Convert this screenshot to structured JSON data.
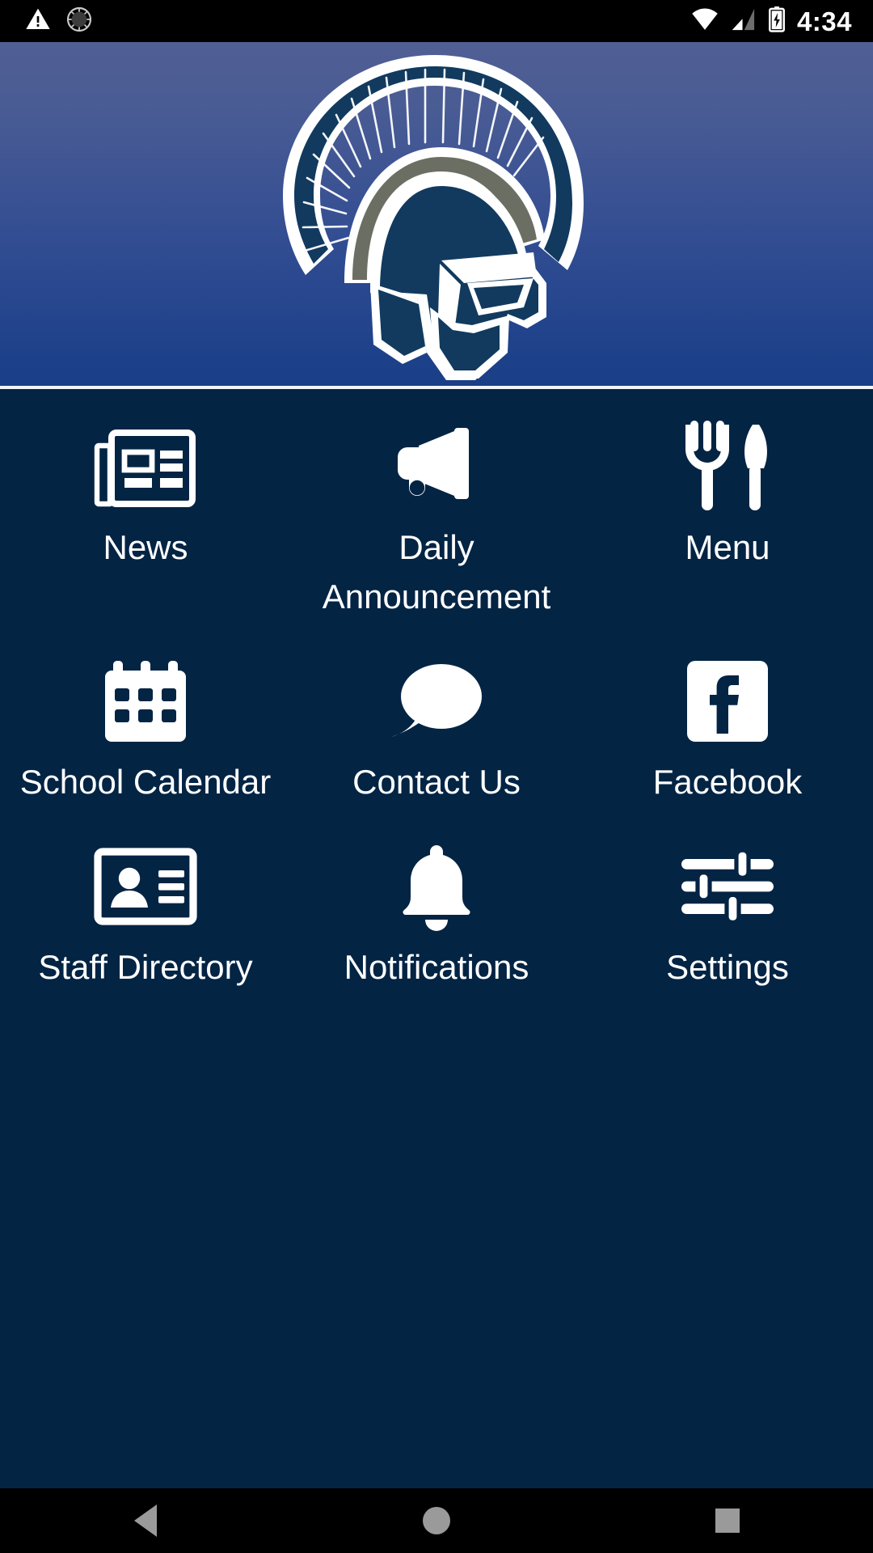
{
  "status_bar": {
    "left_icons": [
      {
        "name": "warning-triangle-icon",
        "label": "warning"
      },
      {
        "name": "sync-spinner-icon",
        "label": "sync"
      }
    ],
    "right_icons": [
      {
        "name": "wifi-icon",
        "label": "wifi"
      },
      {
        "name": "cellular-signal-icon",
        "label": "signal"
      },
      {
        "name": "battery-charging-icon",
        "label": "battery charging"
      }
    ],
    "time": "4:34"
  },
  "header": {
    "logo_name": "spartan-helmet-logo",
    "gradient_top": "#505f94",
    "gradient_bottom": "#1a3f88",
    "logo_fill": "#113a5e",
    "logo_outline": "#ffffff",
    "logo_crest_band": "#6b6f63"
  },
  "theme": {
    "body_background": "#042444",
    "icon_color": "#ffffff",
    "label_color": "#ffffff",
    "statusbar_background": "#000000",
    "navbar_background": "#000000",
    "navbar_icon_color": "#9a9a9a"
  },
  "grid": {
    "rows": [
      [
        {
          "label": "News",
          "icon": "newspaper-icon",
          "key": "news"
        },
        {
          "label": "Daily Announcement",
          "icon": "megaphone-icon",
          "key": "daily-announcement"
        },
        {
          "label": "Menu",
          "icon": "fork-knife-icon",
          "key": "menu"
        }
      ],
      [
        {
          "label": "School Calendar",
          "icon": "calendar-icon",
          "key": "school-calendar"
        },
        {
          "label": "Contact Us",
          "icon": "speech-bubble-icon",
          "key": "contact-us"
        },
        {
          "label": "Facebook",
          "icon": "facebook-icon",
          "key": "facebook"
        }
      ],
      [
        {
          "label": "Staff Directory",
          "icon": "contact-card-icon",
          "key": "staff-directory"
        },
        {
          "label": "Notifications",
          "icon": "bell-icon",
          "key": "notifications"
        },
        {
          "label": "Settings",
          "icon": "sliders-icon",
          "key": "settings"
        }
      ]
    ]
  },
  "nav_bar": {
    "buttons": [
      {
        "name": "nav-back-button",
        "label": "Back"
      },
      {
        "name": "nav-home-button",
        "label": "Home"
      },
      {
        "name": "nav-recents-button",
        "label": "Recents"
      }
    ]
  }
}
